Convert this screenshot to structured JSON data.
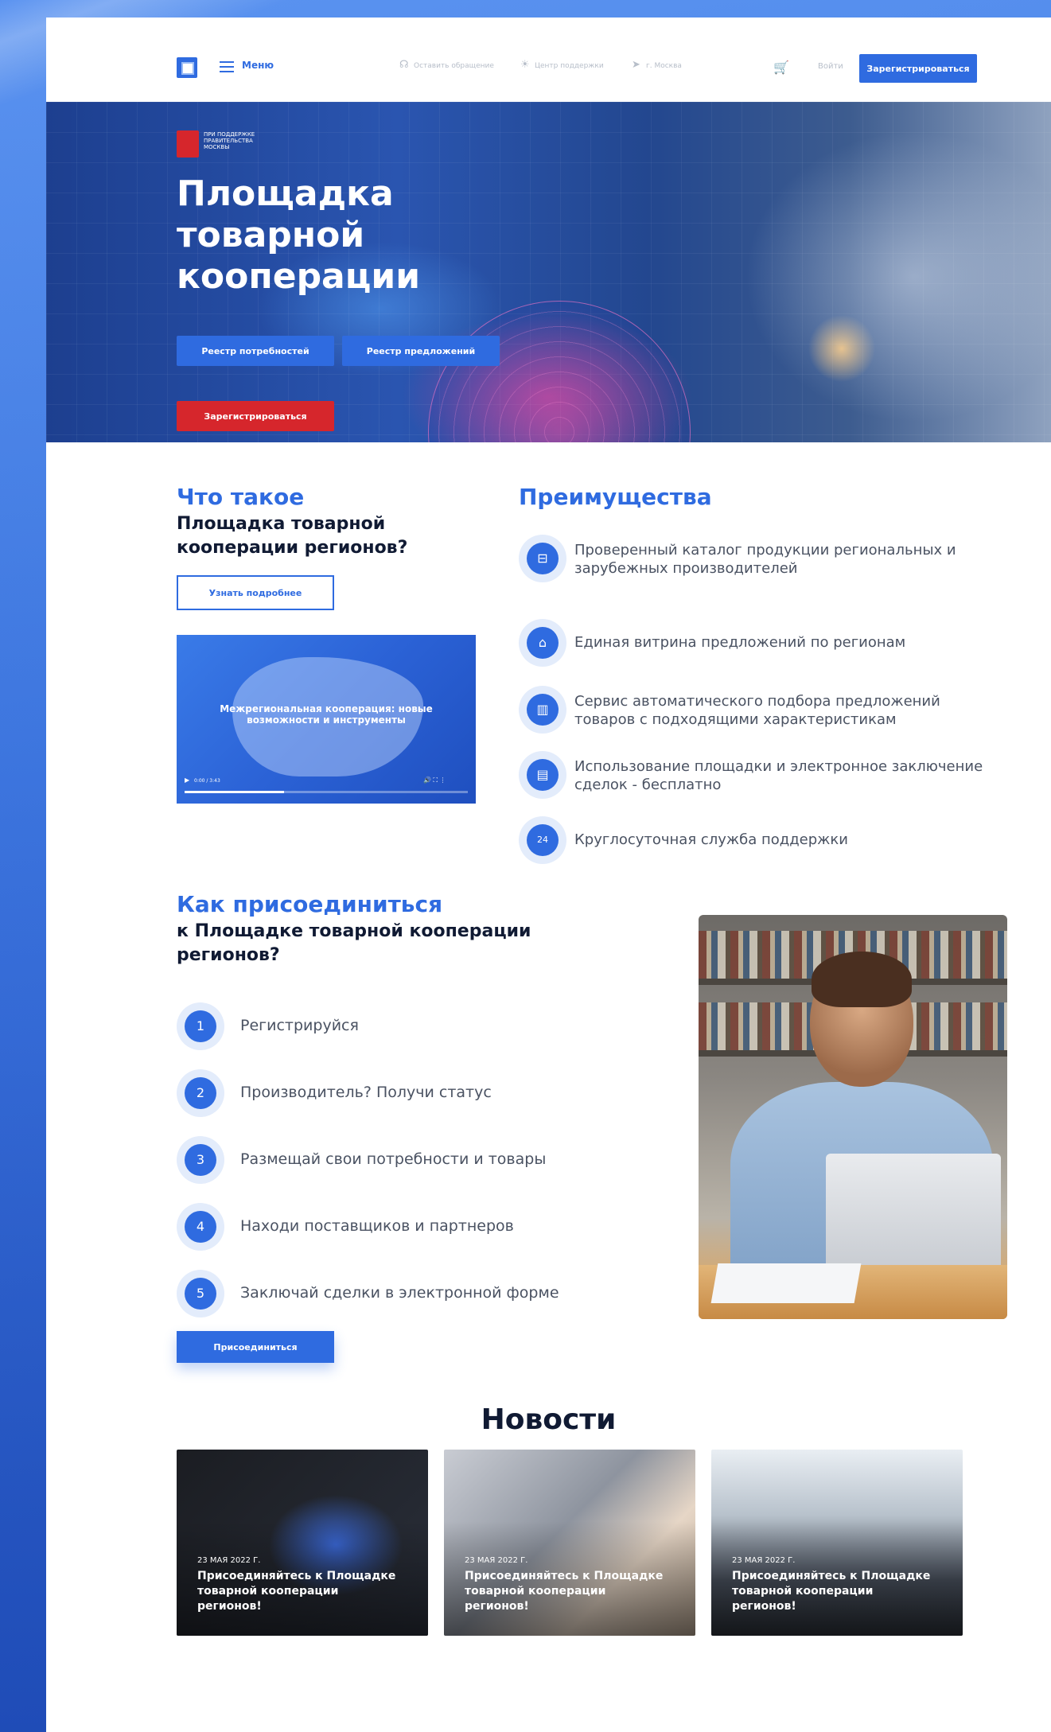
{
  "header": {
    "menu_label": "Меню",
    "links": [
      "Оставить обращение",
      "Центр поддержки",
      "г. Москва"
    ],
    "login_label": "Войти",
    "register_label": "Зарегистрироваться"
  },
  "hero": {
    "gov_text": "При поддержке Правительства Москвы",
    "title": "Площадка товарной кооперации",
    "btn_needs": "Реестр потребностей",
    "btn_offers": "Реестр предложений",
    "btn_register": "Зарегистрироваться"
  },
  "what": {
    "title": "Что такое",
    "subtitle": "Площадка товарной кооперации регионов?",
    "more_label": "Узнать подробнее",
    "video_caption": "Межрегиональная кооперация: новые возможности и инструменты",
    "video_time": "0:00 / 3:43",
    "video_progress": 0.35
  },
  "advantages": {
    "title": "Преимущества",
    "items": [
      {
        "icon": "bag-icon",
        "text": "Проверенный каталог продукции региональных и зарубежных производителей"
      },
      {
        "icon": "storefront-icon",
        "text": "Единая витрина предложений по регионам"
      },
      {
        "icon": "map-icon",
        "text": "Сервис автоматического подбора предложений товаров с подходящими характеристикам"
      },
      {
        "icon": "document-icon",
        "text": "Использование площадки и электронное заключение сделок - бесплатно"
      },
      {
        "icon": "support-24-icon",
        "text": "Круглосуточная служба поддержки"
      }
    ]
  },
  "join": {
    "title": "Как присоединиться",
    "subtitle": "к Площадке товарной кооперации регионов?",
    "steps": [
      {
        "num": "1",
        "text": "Регистрируйся"
      },
      {
        "num": "2",
        "text": "Производитель? Получи статус"
      },
      {
        "num": "3",
        "text": "Размещай свои потребности и товары"
      },
      {
        "num": "4",
        "text": "Находи поставщиков и партнеров"
      },
      {
        "num": "5",
        "text": "Заключай сделки в электронной форме"
      }
    ],
    "button_label": "Присоединиться"
  },
  "news": {
    "title": "Новости",
    "items": [
      {
        "date": "23 МАЯ 2022 Г.",
        "headline": "Присоединяйтесь к Площадке товарной кооперации регионов!"
      },
      {
        "date": "23 МАЯ 2022 Г.",
        "headline": "Присоединяйтесь к Площадке товарной кооперации регионов!"
      },
      {
        "date": "23 МАЯ 2022 Г.",
        "headline": "Присоединяйтесь к Площадке товарной кооперации регионов!"
      }
    ]
  },
  "colors": {
    "accent": "#2f6be0",
    "danger": "#d6262c",
    "text_dark": "#101a33",
    "text_muted": "#4a5262"
  }
}
